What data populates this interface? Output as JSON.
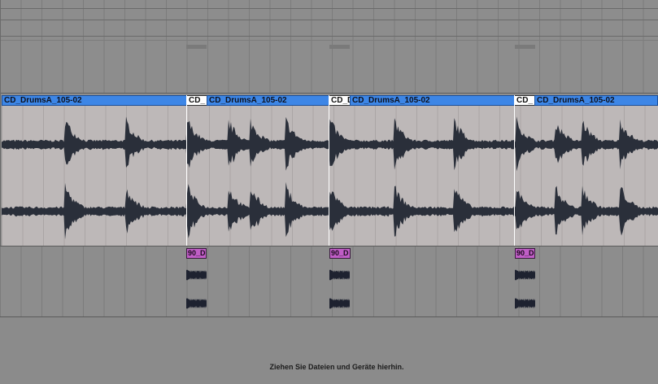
{
  "audio_track": {
    "clips": [
      {
        "label": "CD_DrumsA_105-02",
        "style": "blue"
      },
      {
        "label": "CD_",
        "style": "white"
      },
      {
        "label": "CD_DrumsA_105-02",
        "style": "blue"
      },
      {
        "label": "CD_D",
        "style": "white"
      },
      {
        "label": "CD_DrumsA_105-02",
        "style": "blue"
      },
      {
        "label": "CD_",
        "style": "white"
      },
      {
        "label": "CD_DrumsA_105-02",
        "style": "blue"
      }
    ]
  },
  "midi_track": {
    "clips": [
      {
        "label": "90_D"
      },
      {
        "label": "90_D"
      },
      {
        "label": "90_D"
      }
    ]
  },
  "drop_zone": {
    "text": "Ziehen Sie Dateien und Geräte hierhin."
  },
  "colors": {
    "clip_blue": "#3d86e6",
    "clip_white": "#ffffff",
    "midi_purple": "#c05ec6",
    "waveform": "#2a2f3a",
    "clip_body": "#bdb8b8",
    "background": "#8f8f8f"
  }
}
